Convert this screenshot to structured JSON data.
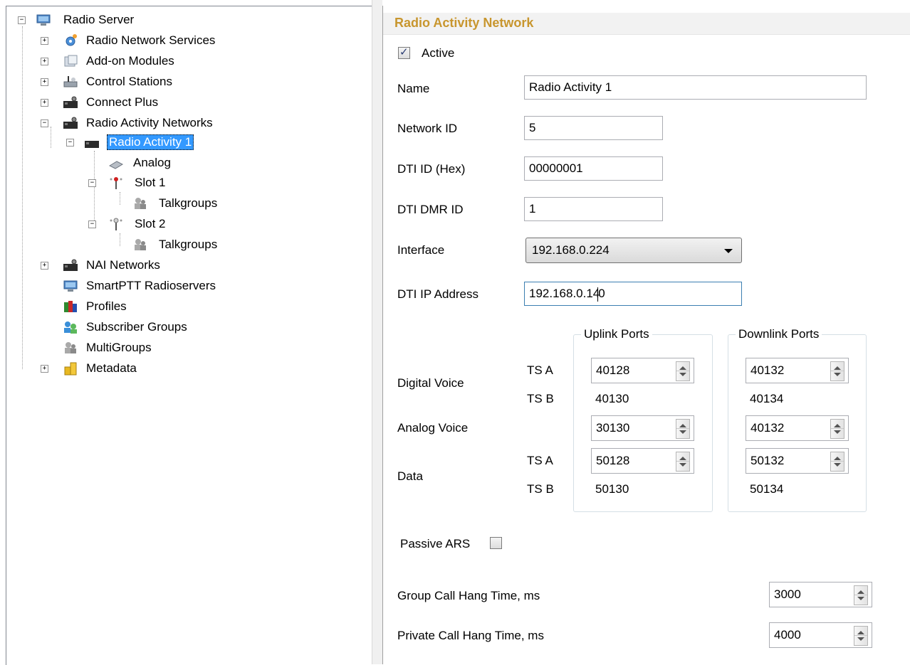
{
  "tree": {
    "root": "Radio Server",
    "items": [
      {
        "label": "Radio Network Services"
      },
      {
        "label": "Add-on Modules"
      },
      {
        "label": "Control Stations"
      },
      {
        "label": "Connect Plus"
      },
      {
        "label": "Radio Activity Networks"
      },
      {
        "label": "Radio Activity 1"
      },
      {
        "label": "Analog"
      },
      {
        "label": "Slot 1"
      },
      {
        "label": "Talkgroups"
      },
      {
        "label": "Slot 2"
      },
      {
        "label": "Talkgroups"
      },
      {
        "label": "NAI Networks"
      },
      {
        "label": "SmartPTT Radioservers"
      },
      {
        "label": "Profiles"
      },
      {
        "label": "Subscriber Groups"
      },
      {
        "label": "MultiGroups"
      },
      {
        "label": "Metadata"
      }
    ],
    "expander_plus": "+",
    "expander_minus": "−"
  },
  "form": {
    "section_title": "Radio Activity Network",
    "active_label": "Active",
    "active_checked": true,
    "name_label": "Name",
    "name_value": "Radio Activity 1",
    "network_id_label": "Network ID",
    "network_id_value": "5",
    "dti_id_label": "DTI ID (Hex)",
    "dti_id_value": "00000001",
    "dti_dmr_id_label": "DTI DMR ID",
    "dti_dmr_id_value": "1",
    "interface_label": "Interface",
    "interface_value": "192.168.0.224",
    "dti_ip_label": "DTI IP Address",
    "dti_ip_value_a": "192.168.0.14",
    "dti_ip_value_b": "0",
    "uplink_title": "Uplink Ports",
    "downlink_title": "Downlink Ports",
    "digital_voice_label": "Digital Voice",
    "analog_voice_label": "Analog Voice",
    "data_label": "Data",
    "ts_a": "TS A",
    "ts_b": "TS B",
    "ports": {
      "digital_ts_a_up": "40128",
      "digital_ts_b_up": "40130",
      "digital_ts_a_down": "40132",
      "digital_ts_b_down": "40134",
      "analog_up": "30130",
      "analog_down": "40132",
      "data_ts_a_up": "50128",
      "data_ts_b_up": "50130",
      "data_ts_a_down": "50132",
      "data_ts_b_down": "50134"
    },
    "passive_ars_label": "Passive ARS",
    "passive_ars_checked": false,
    "group_hang_label": "Group Call Hang Time, ms",
    "group_hang_value": "3000",
    "private_hang_label": "Private Call Hang Time, ms",
    "private_hang_value": "4000"
  },
  "colors": {
    "section_title": "#c8962e",
    "selection": "#3399ff"
  }
}
